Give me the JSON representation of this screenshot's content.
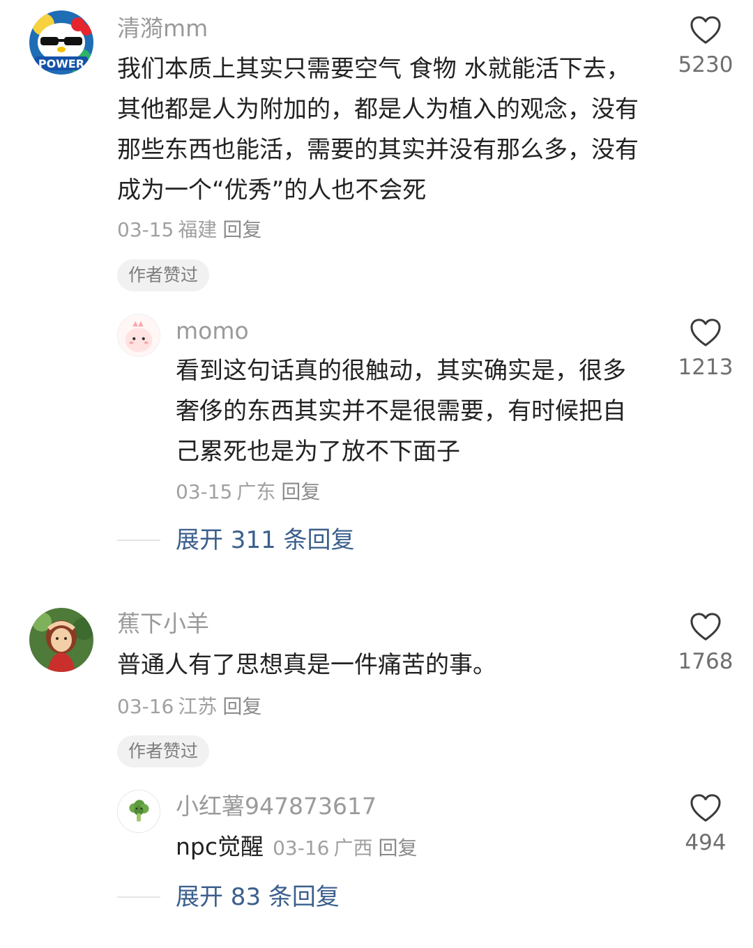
{
  "comments": [
    {
      "username": "清漪mm",
      "content": "我们本质上其实只需要空气 食物 水就能活下去，其他都是人为附加的，都是人为植入的观念，没有那些东西也能活，需要的其实并没有那么多，没有成为一个“优秀”的人也不会死",
      "date": "03-15",
      "location": "福建",
      "reply_label": "回复",
      "author_liked": "作者赞过",
      "likes": "5230",
      "avatar_icon": "hello-kitty-power-avatar",
      "reply": {
        "username": "momo",
        "content": "看到这句话真的很触动，其实确实是，很多奢侈的东西其实并不是很需要，有时候把自己累死也是为了放不下面子",
        "date": "03-15",
        "location": "广东",
        "reply_label": "回复",
        "likes": "1213",
        "avatar_icon": "pink-dino-avatar"
      },
      "expand_label": "展开 311 条回复"
    },
    {
      "username": "蕉下小羊",
      "content": "普通人有了思想真是一件痛苦的事。",
      "date": "03-16",
      "location": "江苏",
      "reply_label": "回复",
      "author_liked": "作者赞过",
      "likes": "1768",
      "avatar_icon": "anime-girl-avatar",
      "reply": {
        "username": "小红薯947873617",
        "content": "npc觉醒",
        "date": "03-16",
        "location": "广西",
        "reply_label": "回复",
        "likes": "494",
        "avatar_icon": "broccoli-avatar"
      },
      "expand_label": "展开 83 条回复"
    }
  ],
  "colors": {
    "username": "#9a9a9a",
    "meta": "#a0a0a0",
    "expand_link": "#3b5f8c",
    "tag_bg": "#f1f1f1"
  },
  "icons": {
    "like": "heart-outline-icon"
  }
}
